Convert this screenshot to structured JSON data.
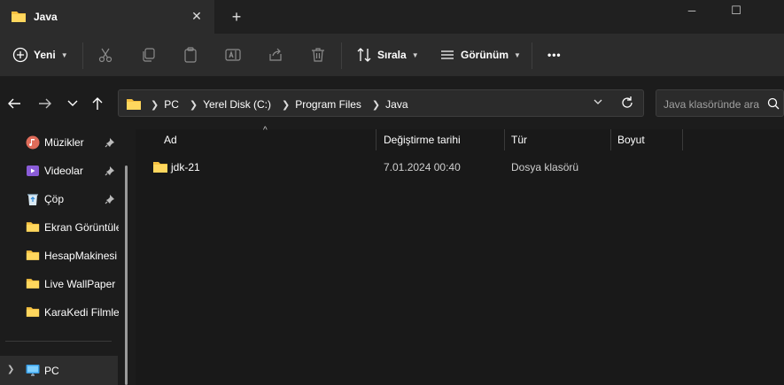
{
  "window": {
    "tab_title": "Java",
    "tab_close": "✕",
    "new_tab": "+",
    "minimize": "─",
    "maximize": "☐"
  },
  "toolbar": {
    "new_label": "Yeni",
    "sort_label": "Sırala",
    "view_label": "Görünüm",
    "more_label": "•••"
  },
  "address": {
    "crumbs": [
      "PC",
      "Yerel Disk (C:)",
      "Program Files",
      "Java"
    ]
  },
  "search": {
    "placeholder": "Java klasöründe ara"
  },
  "sidebar": {
    "items": [
      {
        "label": "Müzikler",
        "icon": "music-icon",
        "pinned": true
      },
      {
        "label": "Videolar",
        "icon": "video-icon",
        "pinned": true
      },
      {
        "label": "Çöp",
        "icon": "recycle-bin-icon",
        "pinned": true
      },
      {
        "label": "Ekran Görüntüleri",
        "icon": "folder-icon",
        "pinned": false
      },
      {
        "label": "HesapMakinesi",
        "icon": "folder-icon",
        "pinned": false
      },
      {
        "label": "Live WallPaper Fo",
        "icon": "folder-icon",
        "pinned": false
      },
      {
        "label": "KaraKedi Filmleri",
        "icon": "folder-icon",
        "pinned": false
      }
    ],
    "pc_label": "PC"
  },
  "columns": {
    "name": "Ad",
    "modified": "Değiştirme tarihi",
    "type": "Tür",
    "size": "Boyut"
  },
  "files": [
    {
      "name": "jdk-21",
      "modified": "7.01.2024 00:40",
      "type": "Dosya klasörü",
      "size": ""
    }
  ],
  "colors": {
    "folder": "#f5c040",
    "background": "#191919",
    "toolbar": "#2c2c2c"
  }
}
